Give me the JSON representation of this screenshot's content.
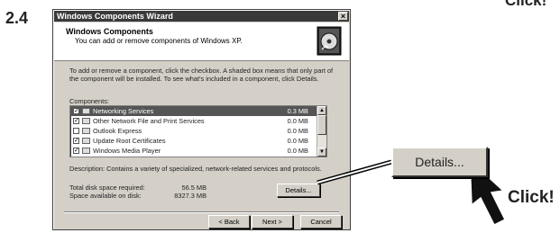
{
  "step_number": "2.4",
  "callout_click_top": "Click!",
  "callout_click_bottom": "Click!",
  "window": {
    "title": "Windows Components Wizard",
    "close_glyph": "×",
    "header_title": "Windows Components",
    "header_subtitle": "You can add or remove components of Windows XP.",
    "instructions": "To add or remove a component, click the checkbox. A shaded box means that only part of the component will be installed. To see what's included in a component, click Details.",
    "components_label": "Components:",
    "components": [
      {
        "name": "Networking Services",
        "size": "0.3 MB",
        "checked": "checked",
        "selected": true,
        "icon": "network-icon"
      },
      {
        "name": "Other Network File and Print Services",
        "size": "0.0 MB",
        "checked": "checked",
        "selected": false,
        "icon": "printer-icon"
      },
      {
        "name": "Outlook Express",
        "size": "0.0 MB",
        "checked": "unchecked",
        "selected": false,
        "icon": "mail-icon"
      },
      {
        "name": "Update Root Certificates",
        "size": "0.0 MB",
        "checked": "checked",
        "selected": false,
        "icon": "certificate-icon"
      },
      {
        "name": "Windows Media Player",
        "size": "0.0 MB",
        "checked": "checked",
        "selected": false,
        "icon": "media-player-icon"
      }
    ],
    "description": "Description:   Contains a variety of specialized, network-related services and protocols.",
    "disk_required_label": "Total disk space required:",
    "disk_required_value": "56.5 MB",
    "disk_available_label": "Space available on disk:",
    "disk_available_value": "8327.3 MB",
    "details_button": "Details...",
    "back_button": "< Back",
    "next_button": "Next >",
    "cancel_button": "Cancel"
  },
  "zoomed_details_button": "Details...",
  "colors": {
    "titlebar": "#3a3a3a",
    "dialog": "#d4d0c8",
    "selection": "#555555"
  }
}
